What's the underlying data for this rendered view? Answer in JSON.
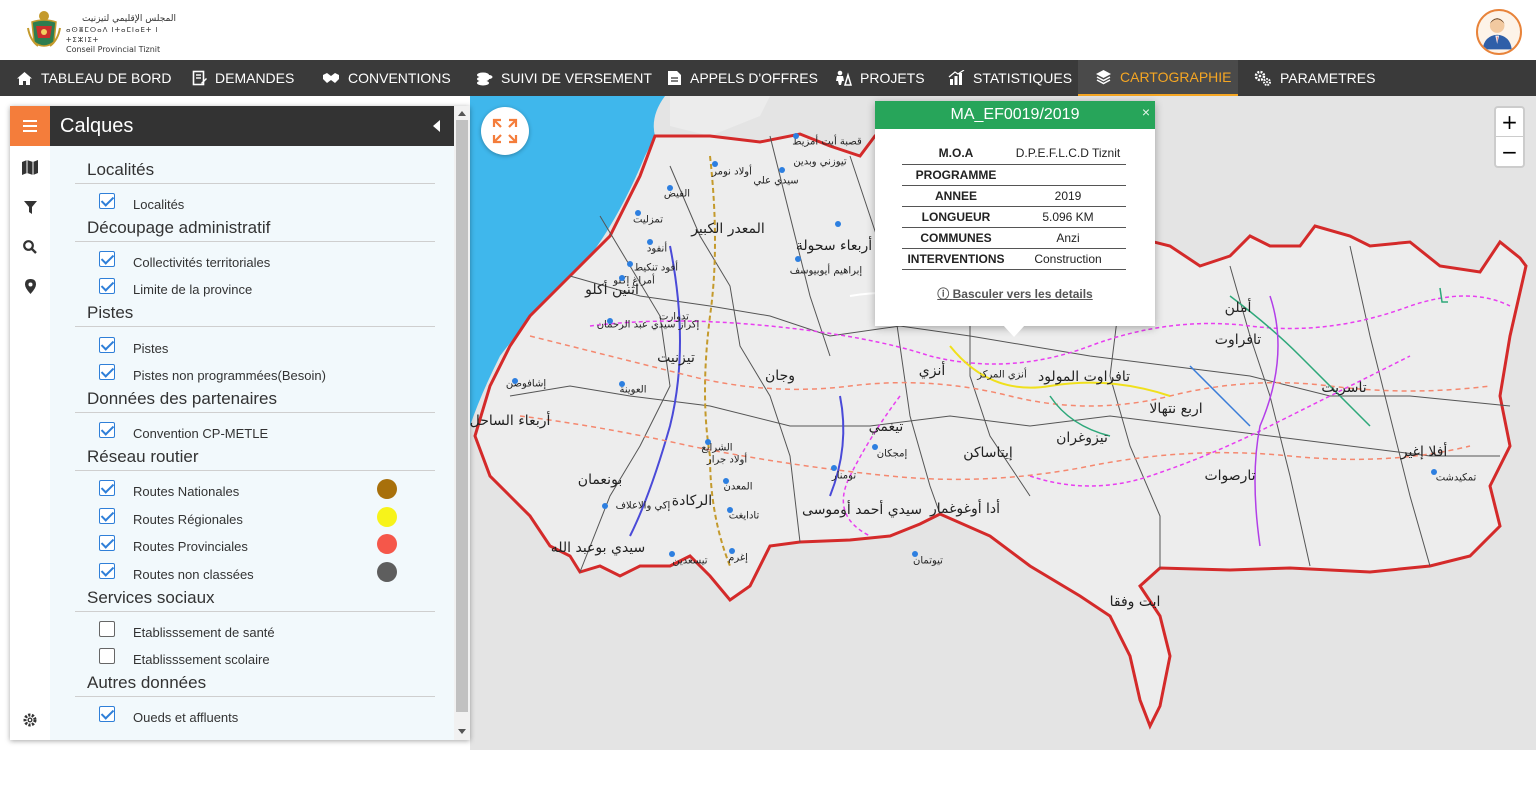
{
  "header": {
    "logo_arabic": "المجلس الإقليمي لتيزنيت",
    "logo_tifinagh": "ⴰⵙⴻⵎⵔⴰⴷ ⵏⵜⴰⵎⵏⴰⴹⵜ ⵏ ⵜⵉⵣⵏⵉⵜ",
    "logo_french": "Conseil Provincial Tiznit"
  },
  "nav": [
    {
      "label": "TABLEAU DE BORD",
      "icon": "home-icon"
    },
    {
      "label": "DEMANDES",
      "icon": "document-edit-icon"
    },
    {
      "label": "CONVENTIONS",
      "icon": "handshake-icon"
    },
    {
      "label": "SUIVI DE VERSEMENT",
      "icon": "coins-icon"
    },
    {
      "label": "APPELS D'OFFRES",
      "icon": "file-icon"
    },
    {
      "label": "PROJETS",
      "icon": "road-worker-icon"
    },
    {
      "label": "STATISTIQUES",
      "icon": "bar-chart-icon"
    },
    {
      "label": "CARTOGRAPHIE",
      "icon": "layers-icon",
      "active": true
    },
    {
      "label": "PARAMETRES",
      "icon": "gears-icon"
    }
  ],
  "sidebar": {
    "title": "Calques",
    "sections": [
      {
        "title": "Localités",
        "items": [
          {
            "label": "Localités",
            "checked": true
          }
        ]
      },
      {
        "title": "Découpage administratif",
        "items": [
          {
            "label": "Collectivités territoriales",
            "checked": true
          },
          {
            "label": "Limite de la province",
            "checked": true
          }
        ]
      },
      {
        "title": "Pistes",
        "items": [
          {
            "label": "Pistes",
            "checked": true
          },
          {
            "label": "Pistes non programmées(Besoin)",
            "checked": true
          }
        ]
      },
      {
        "title": "Données des partenaires",
        "items": [
          {
            "label": "Convention CP-METLE",
            "checked": true
          }
        ]
      },
      {
        "title": "Réseau routier",
        "items": [
          {
            "label": "Routes Nationales",
            "checked": true,
            "color": "#a8700b"
          },
          {
            "label": "Routes Régionales",
            "checked": true,
            "color": "#f7f31a"
          },
          {
            "label": "Routes Provinciales",
            "checked": true,
            "color": "#f5574a"
          },
          {
            "label": "Routes non classées",
            "checked": true,
            "color": "#5e5e5e"
          }
        ]
      },
      {
        "title": "Services sociaux",
        "items": [
          {
            "label": "Etablisssement de santé",
            "checked": false
          },
          {
            "label": "Etablisssement scolaire",
            "checked": false
          }
        ]
      },
      {
        "title": "Autres données",
        "items": [
          {
            "label": "Oueds et affluents",
            "checked": true
          }
        ]
      }
    ]
  },
  "popup": {
    "title": "MA_EF0019/2019",
    "close": "×",
    "rows": [
      {
        "key": "M.O.A",
        "value": "D.P.E.F.L.C.D Tiznit"
      },
      {
        "key": "PROGRAMME",
        "value": ""
      },
      {
        "key": "ANNEE",
        "value": "2019"
      },
      {
        "key": "LONGUEUR",
        "value": "5.096 KM"
      },
      {
        "key": "COMMUNES",
        "value": "Anzi"
      },
      {
        "key": "INTERVENTIONS",
        "value": "Construction"
      }
    ],
    "link": "Basculer vers les details"
  },
  "map": {
    "zoom_in": "+",
    "zoom_out": "−",
    "places_big": [
      "المعدر الكبير",
      "بونعمان",
      "تيزنيت",
      "وجان",
      "أنزي",
      "تافراوت المولود",
      "أربعاء الساحل",
      "الركادة",
      "سيدي بوعبد الله",
      "سيدي أحمد أوموسى",
      "أدا أوغوغمار",
      "إيتاساكن",
      "تيزوغران",
      "اربع نتهالا",
      "تارصوات",
      "أملن",
      "تافراوت",
      "تاسريت",
      "أفلا إغير",
      "ايت وفقا",
      "تيغمي",
      "أربعاء سحولة",
      "اثنين أكلو"
    ],
    "places_small": [
      "قصبة أيت أمزيط",
      "أولاد نومر",
      "تيوزني وبدين",
      "سيدي علي",
      "الفيض",
      "تمزليت",
      "أنفود",
      "أفود تنكيط",
      "إبراهيم أيوبيوسف",
      "أمراغ إكلو",
      "تدوارت",
      "إكراز سيدي عبد الرحمان",
      "العوينة",
      "إشافوضن",
      "الشرايع",
      "أولاد جرار",
      "المعدن",
      "إكي والاعلاف",
      "تادايغت",
      "إغرم",
      "تيسعدين",
      "تومنار",
      "إمجكان",
      "تيوتمان",
      "أنزي المركز",
      "تمكيدشت"
    ]
  }
}
